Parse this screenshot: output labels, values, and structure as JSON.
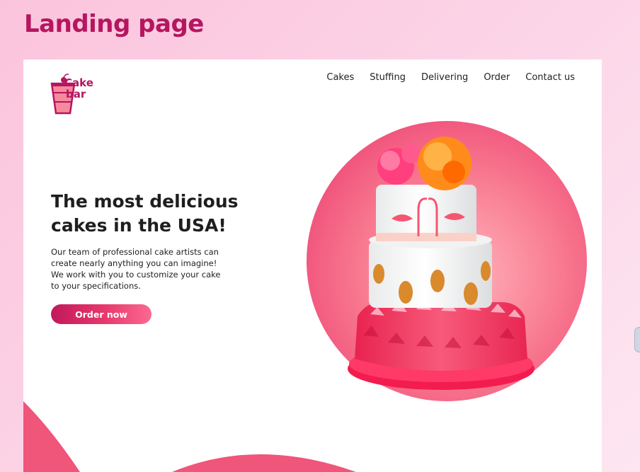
{
  "page_heading": "Landing page",
  "brand": {
    "logo_line1": "Cake",
    "logo_line2": "bar",
    "logo_icon": "cake-cup-icon",
    "accent_color": "#b51660"
  },
  "nav": {
    "items": [
      "Cakes",
      "Stuffing",
      "Delivering",
      "Order",
      "Contact us"
    ]
  },
  "hero": {
    "title_line1": "The most delicious",
    "title_line2": "cakes in the USA!",
    "copy_lines": [
      "Our team of professional cake artists can",
      "create nearly anything you can imagine!",
      "We work with you to customize your cake",
      "to your specifications."
    ],
    "cta_label": "Order now",
    "image": "flamingo-tiered-cake-image"
  },
  "colors": {
    "circle": "#f66a86",
    "cta_start": "#c2185b",
    "cta_end": "#fb6a90",
    "wave": "#f0557a"
  }
}
